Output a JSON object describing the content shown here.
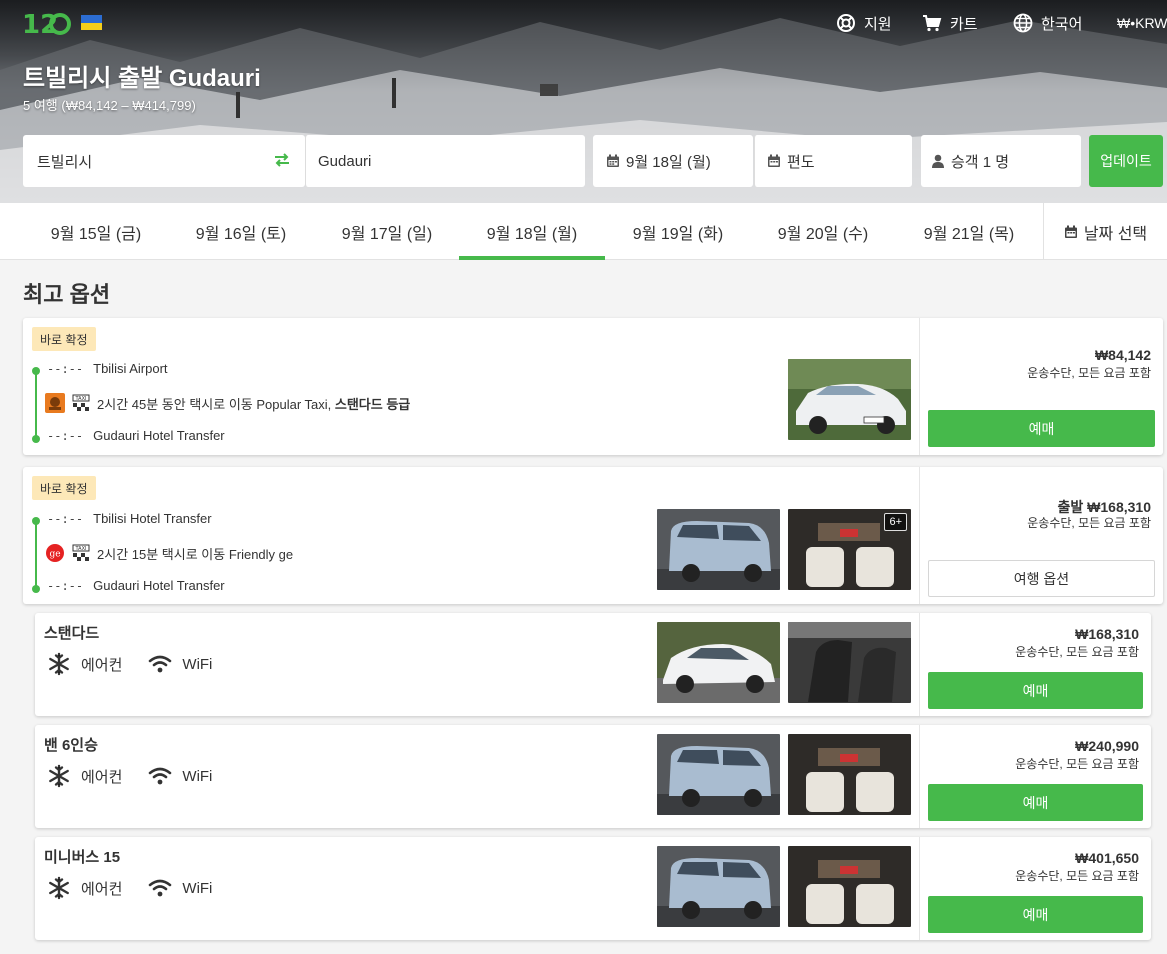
{
  "colors": {
    "accent": "#46b94b",
    "badge_bg": "#fde8b8"
  },
  "header": {
    "logo_text": "12GO",
    "nav": [
      {
        "icon": "support-icon",
        "label": "지원"
      },
      {
        "icon": "cart-icon",
        "label": "카트"
      },
      {
        "icon": "globe-icon",
        "label": "한국어"
      },
      {
        "icon": "",
        "label": "₩•KRW"
      }
    ]
  },
  "route": {
    "title": "트빌리시 출발 Gudauri",
    "subtitle": "5 여행 (₩84,142 – ₩414,799)"
  },
  "search": {
    "from": "트빌리시",
    "to": "Gudauri",
    "date": "9월 18일 (월)",
    "trip_type": "편도",
    "passengers": "승객 1 명",
    "update_label": "업데이트"
  },
  "date_tabs": [
    {
      "label": "9월 15일 (금)",
      "active": false
    },
    {
      "label": "9월 16일 (토)",
      "active": false
    },
    {
      "label": "9월 17일 (일)",
      "active": false
    },
    {
      "label": "9월 18일 (월)",
      "active": true
    },
    {
      "label": "9월 19일 (화)",
      "active": false
    },
    {
      "label": "9월 20일 (수)",
      "active": false
    },
    {
      "label": "9월 21일 (목)",
      "active": false
    }
  ],
  "date_pick_label": "날짜 선택",
  "section_title": "최고 옵션",
  "trips": [
    {
      "badge": "바로 확정",
      "dep_time": "--:--",
      "dep_place": "Tbilisi Airport",
      "travel_text": "2시간 45분 동안 택시로 이동 Popular Taxi, ",
      "travel_class": "스탠다드 등급",
      "arr_time": "--:--",
      "arr_place": "Gudauri Hotel Transfer",
      "price": "₩84,142",
      "price_note": "운송수단, 모든 요금 포함",
      "button": "예매"
    },
    {
      "badge": "바로 확정",
      "dep_time": "--:--",
      "dep_place": "Tbilisi Hotel Transfer",
      "travel_text": "2시간 15분 택시로 이동 Friendly ge",
      "operator_logo_text": "ge",
      "arr_time": "--:--",
      "arr_place": "Gudauri Hotel Transfer",
      "more_photos": "6+",
      "price": "출발 ₩168,310",
      "price_note": "운송수단, 모든 요금 포함",
      "button": "여행 옵션"
    }
  ],
  "classes": [
    {
      "name": "스탠다드",
      "amenity_ac": "에어컨",
      "amenity_wifi": "WiFi",
      "price": "₩168,310",
      "price_note": "운송수단, 모든 요금 포함",
      "button": "예매"
    },
    {
      "name": "밴 6인승",
      "amenity_ac": "에어컨",
      "amenity_wifi": "WiFi",
      "price": "₩240,990",
      "price_note": "운송수단, 모든 요금 포함",
      "button": "예매"
    },
    {
      "name": "미니버스 15",
      "amenity_ac": "에어컨",
      "amenity_wifi": "WiFi",
      "price": "₩401,650",
      "price_note": "운송수단, 모든 요금 포함",
      "button": "예매"
    }
  ]
}
